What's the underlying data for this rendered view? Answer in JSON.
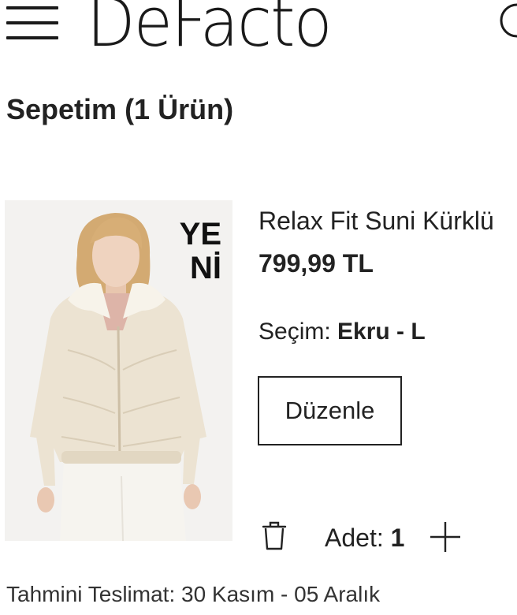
{
  "header": {
    "logo_text": "DeFacto",
    "menu_icon": "hamburger-menu-icon",
    "search_icon": "search-icon"
  },
  "cart": {
    "title": "Sepetim",
    "count_label": "(1 Ürün)"
  },
  "item": {
    "image_badge_line1": "YE",
    "image_badge_line2": "Nİ",
    "name": "Relax Fit Suni Kürklü",
    "price": "799,99 TL",
    "selection_label": "Seçim:",
    "selection_value": "Ekru - L",
    "edit_button": "Düzenle",
    "delete_icon": "trash-icon",
    "quantity_label": "Adet:",
    "quantity_value": "1",
    "increase_icon": "plus-icon"
  },
  "delivery": {
    "text": "Tahmini Teslimat: 30 Kasım - 05 Aralık"
  },
  "colors": {
    "text": "#222222",
    "image_background": "#f3f2f0",
    "jacket": "#ece3d2"
  }
}
